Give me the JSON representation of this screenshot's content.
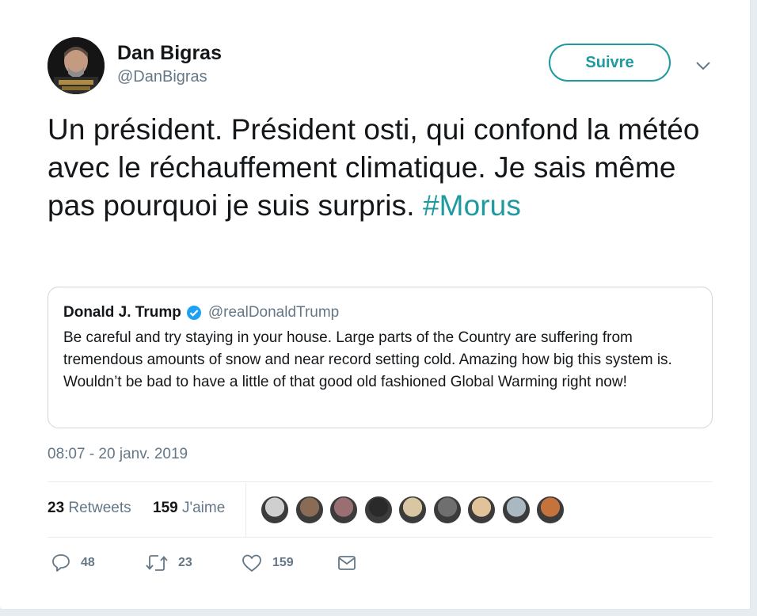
{
  "author": {
    "display_name": "Dan Bigras",
    "handle": "@DanBigras",
    "avatar_icon": "profile-photo"
  },
  "follow_button": {
    "label": "Suivre",
    "color": "#1e9aa0"
  },
  "more_menu": {
    "icon": "chevron-down-icon"
  },
  "tweet": {
    "text": "Un président. Président osti, qui confond la météo avec le réchauffement climatique. Je sais même pas pourquoi je suis surpris. ",
    "hashtag": "#Morus"
  },
  "quoted_tweet": {
    "display_name": "Donald J. Trump",
    "verified_icon": "verified-badge-icon",
    "handle": "@realDonaldTrump",
    "text": "Be careful and try staying in your house. Large parts of the Country are suffering from tremendous amounts of snow and near record setting cold. Amazing how big this system is. Wouldn’t be bad to have a little of that good old fashioned Global Warming right now!"
  },
  "timestamp": "08:07 - 20 janv. 2019",
  "stats": {
    "retweets_count": "23",
    "retweets_label": "Retweets",
    "likes_count": "159",
    "likes_label": "J'aime"
  },
  "likers": [
    {
      "name": "liker-avatar-1",
      "color": "#cfcfcf"
    },
    {
      "name": "liker-avatar-2",
      "color": "#8a6b55"
    },
    {
      "name": "liker-avatar-3",
      "color": "#9a6f73"
    },
    {
      "name": "liker-avatar-4",
      "color": "#2a2a2a"
    },
    {
      "name": "liker-avatar-5",
      "color": "#d9c7a3"
    },
    {
      "name": "liker-avatar-6",
      "color": "#6f6f6f"
    },
    {
      "name": "liker-avatar-7",
      "color": "#e0c39a"
    },
    {
      "name": "liker-avatar-8",
      "color": "#aab8c2"
    },
    {
      "name": "liker-avatar-9",
      "color": "#c4733d"
    }
  ],
  "actions": {
    "reply": {
      "icon": "reply-icon",
      "count": "48"
    },
    "retweet": {
      "icon": "retweet-icon",
      "count": "23"
    },
    "like": {
      "icon": "heart-icon",
      "count": "159"
    },
    "message": {
      "icon": "envelope-icon"
    }
  }
}
